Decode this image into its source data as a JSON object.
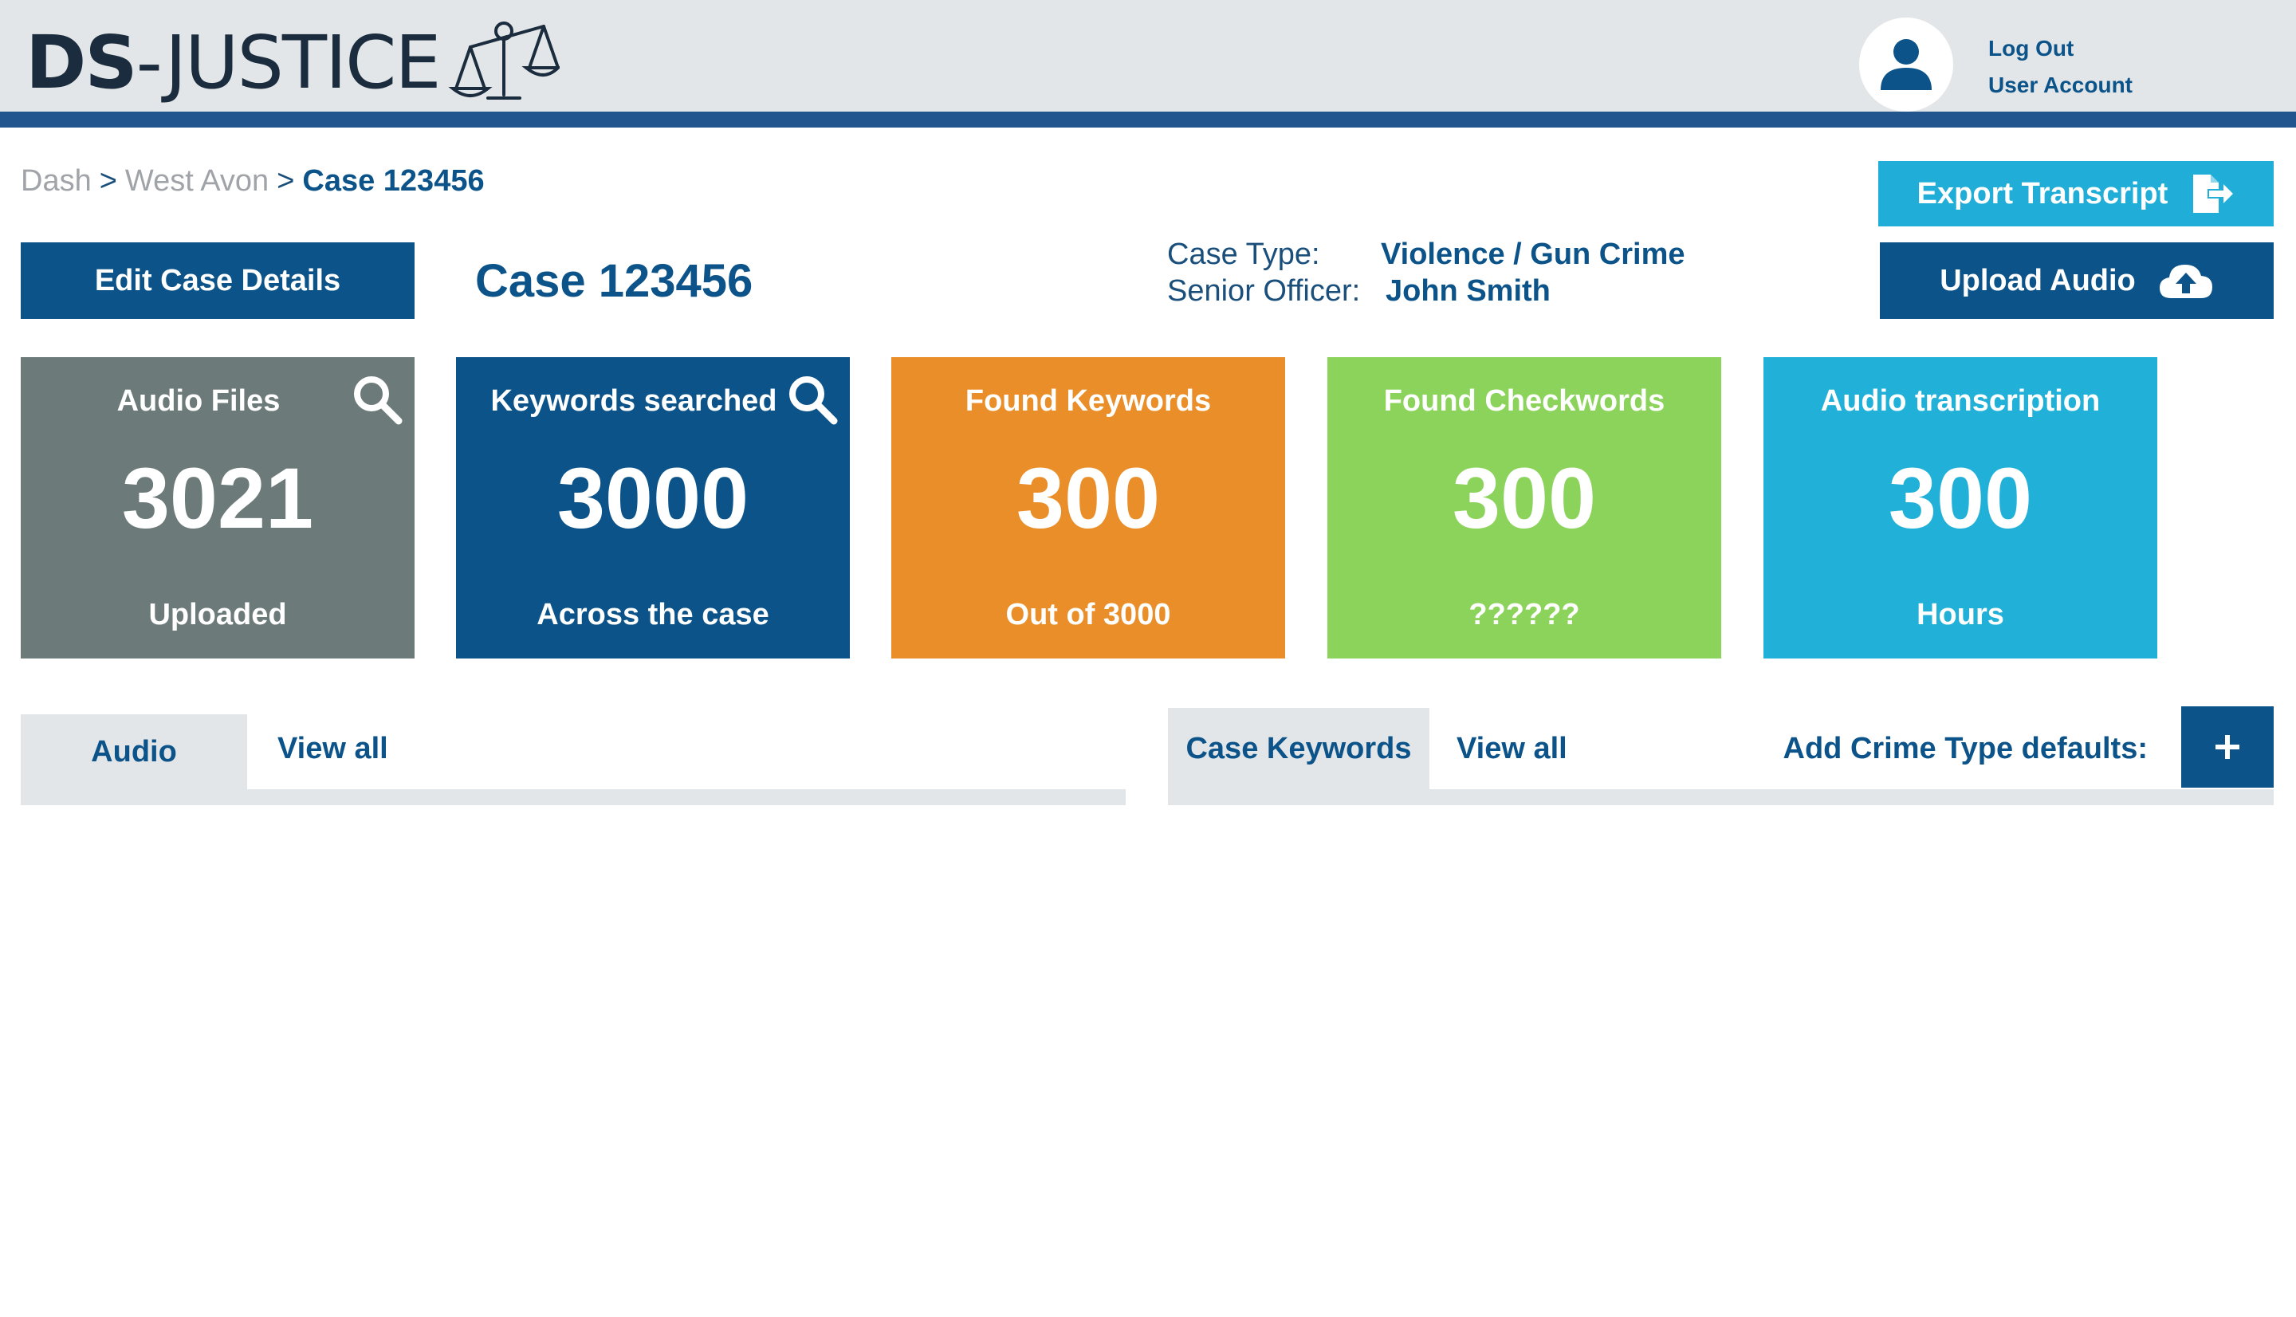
{
  "header": {
    "logo_prefix": "DS",
    "logo_dash": "-",
    "logo_suffix": "JUSTICE",
    "logo_icon": "scales-icon",
    "avatar_icon": "user-icon",
    "log_out_label": "Log Out",
    "user_account_label": "User Account"
  },
  "breadcrumb": {
    "items": [
      "Dash",
      "West Avon"
    ],
    "separator": ">",
    "current": "Case 123456"
  },
  "actions": {
    "edit_label": "Edit Case Details",
    "export_label": "Export Transcript",
    "export_icon": "export-file-icon",
    "upload_label": "Upload Audio",
    "upload_icon": "cloud-upload-icon"
  },
  "case": {
    "title": "Case 123456",
    "type_label": "Case Type:",
    "type_value": "Violence / Gun Crime",
    "officer_label": "Senior Officer:",
    "officer_value": "John Smith"
  },
  "stats": [
    {
      "title": "Audio Files",
      "value": "3021",
      "sub": "Uploaded",
      "color": "#6c7a79",
      "icon": "search-icon"
    },
    {
      "title": "Keywords searched",
      "value": "3000",
      "sub": "Across the case",
      "color": "#0b5389",
      "icon": "search-icon"
    },
    {
      "title": "Found Keywords",
      "value": "300",
      "sub": "Out of 3000",
      "color": "#e98e28"
    },
    {
      "title": "Found Checkwords",
      "value": "300",
      "sub": "??????",
      "color": "#8bd35a"
    },
    {
      "title": "Audio transcription",
      "value": "300",
      "sub": "Hours",
      "color": "#20b0d8"
    }
  ],
  "panels": {
    "audio": {
      "tab_label": "Audio",
      "view_all_label": "View all"
    },
    "keywords": {
      "tab_label": "Case Keywords",
      "view_all_label": "View all",
      "add_label": "Add Crime Type defaults:",
      "add_button": "+"
    }
  },
  "colors": {
    "primary": "#0b5389",
    "header_bg": "#e3e6e8",
    "header_border": "#22558e",
    "cyan": "#20add8"
  }
}
